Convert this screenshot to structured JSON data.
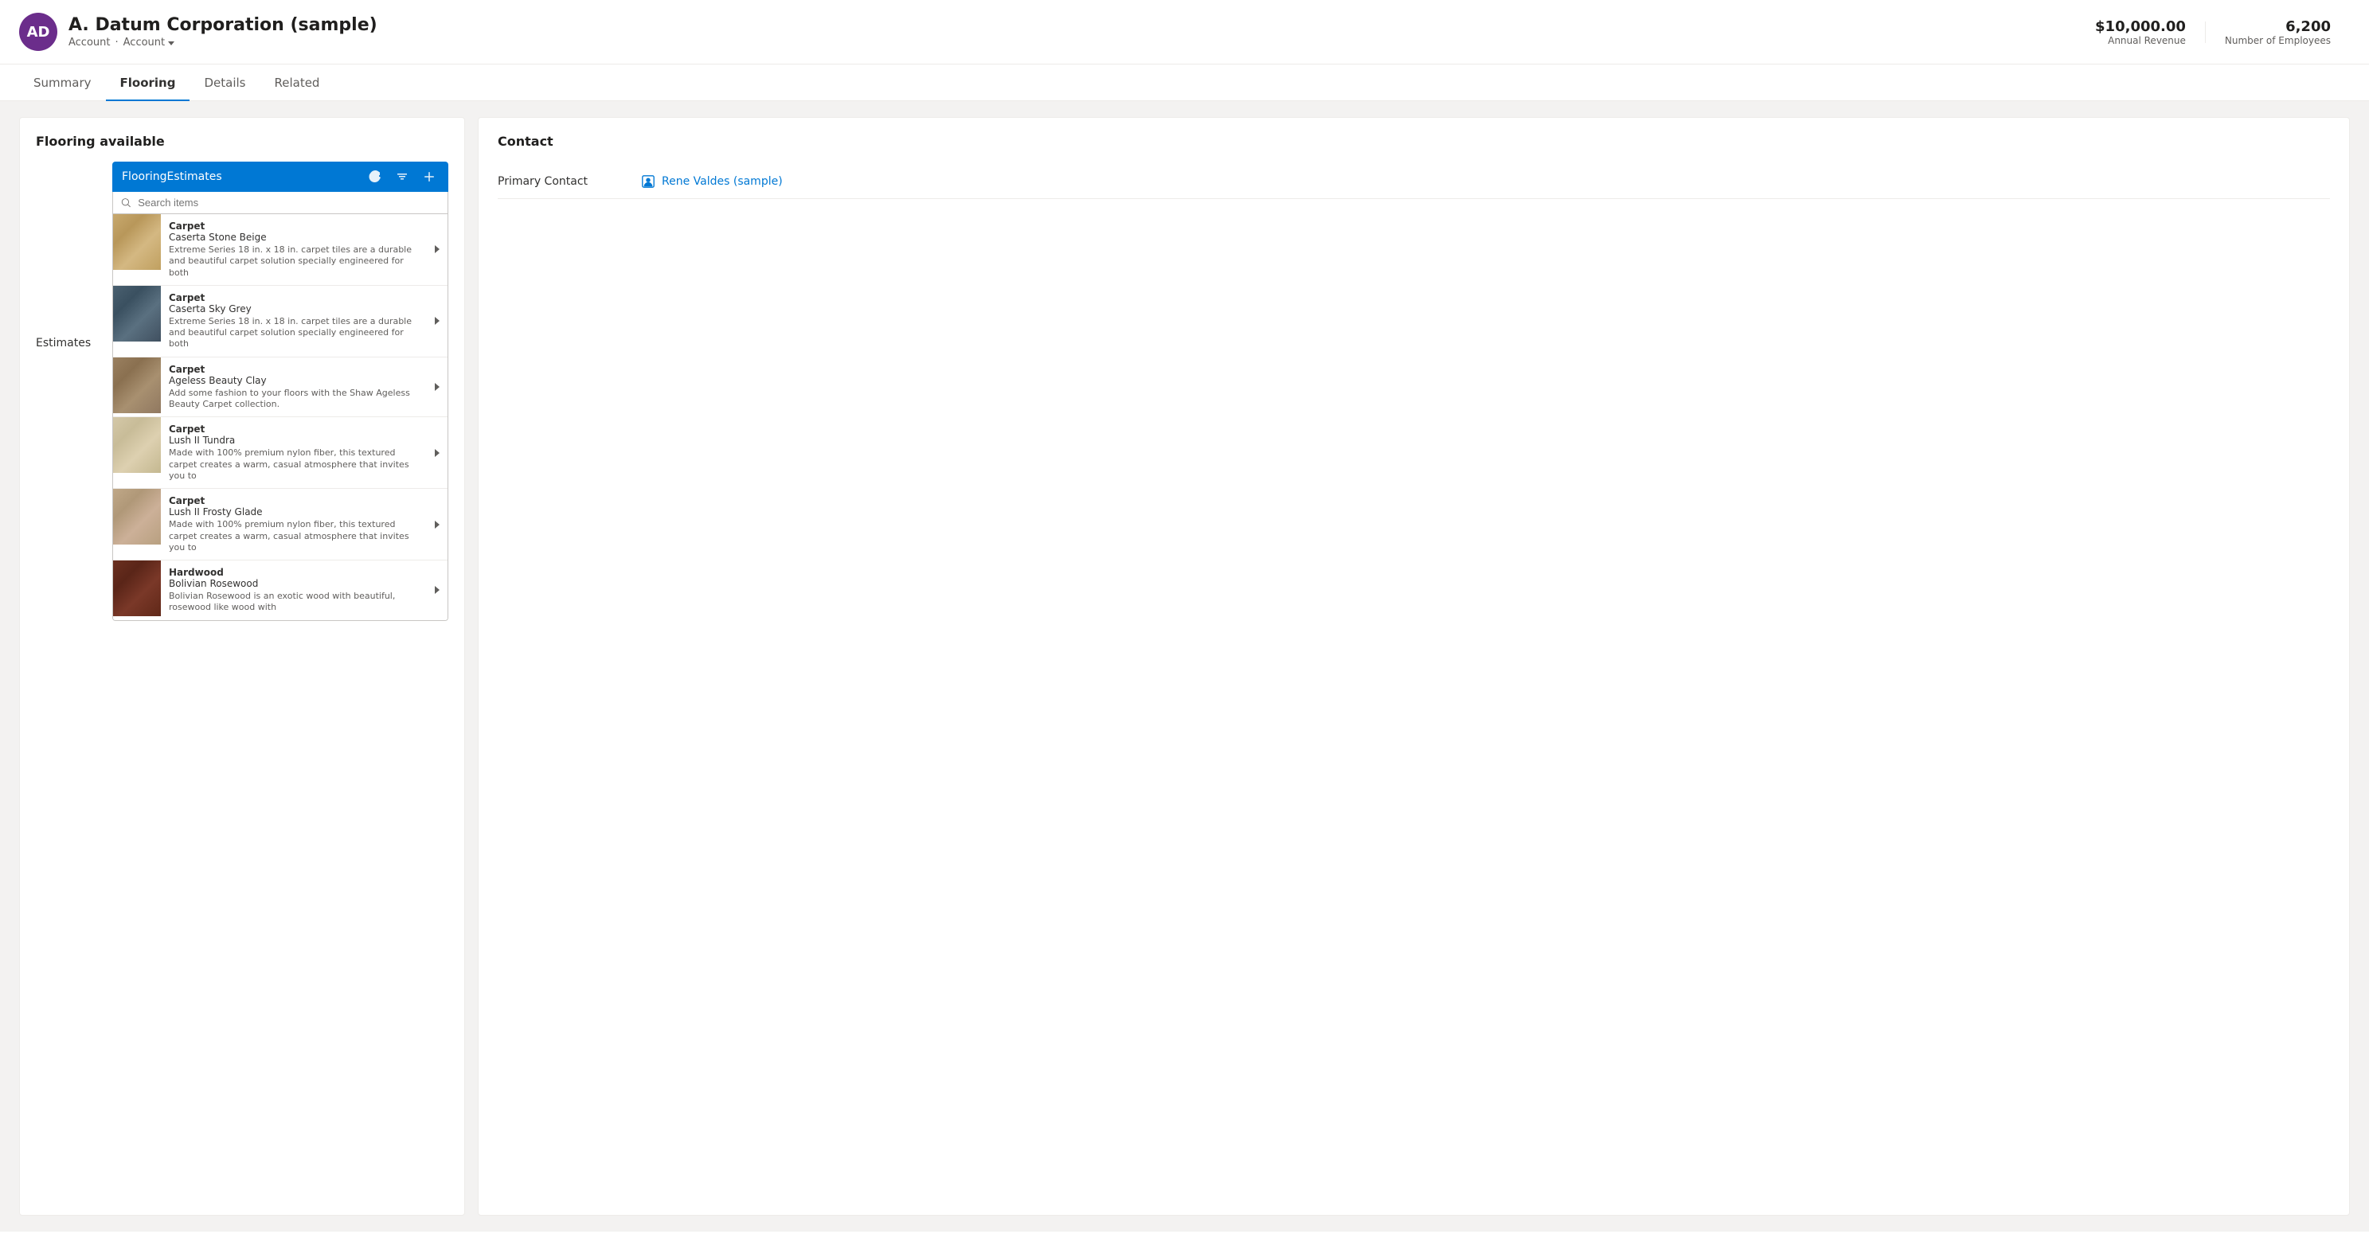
{
  "header": {
    "avatar_initials": "AD",
    "title": "A. Datum Corporation (sample)",
    "subtitle1": "Account",
    "subtitle2": "Account",
    "annual_revenue_label": "Annual Revenue",
    "annual_revenue_value": "$10,000.00",
    "employees_label": "Number of Employees",
    "employees_value": "6,200"
  },
  "nav": {
    "tabs": [
      {
        "label": "Summary",
        "active": false
      },
      {
        "label": "Flooring",
        "active": true
      },
      {
        "label": "Details",
        "active": false
      },
      {
        "label": "Related",
        "active": false
      }
    ]
  },
  "left_panel": {
    "title": "Flooring available",
    "sidebar_label": "Estimates",
    "toolbar_label": "FlooringEstimates",
    "search_placeholder": "Search items",
    "products": [
      {
        "category": "Carpet",
        "name": "Caserta Stone Beige",
        "description": "Extreme Series 18 in. x 18 in. carpet tiles are a durable and beautiful carpet solution specially engineered for both",
        "thumb_class": "thumb-beige"
      },
      {
        "category": "Carpet",
        "name": "Caserta Sky Grey",
        "description": "Extreme Series 18 in. x 18 in. carpet tiles are a durable and beautiful carpet solution specially engineered for both",
        "thumb_class": "thumb-grey"
      },
      {
        "category": "Carpet",
        "name": "Ageless Beauty Clay",
        "description": "Add some fashion to your floors with the Shaw Ageless Beauty Carpet collection.",
        "thumb_class": "thumb-clay"
      },
      {
        "category": "Carpet",
        "name": "Lush II Tundra",
        "description": "Made with 100% premium nylon fiber, this textured carpet creates a warm, casual atmosphere that invites you to",
        "thumb_class": "thumb-tundra"
      },
      {
        "category": "Carpet",
        "name": "Lush II Frosty Glade",
        "description": "Made with 100% premium nylon fiber, this textured carpet creates a warm, casual atmosphere that invites you to",
        "thumb_class": "thumb-frosty"
      },
      {
        "category": "Hardwood",
        "name": "Bolivian Rosewood",
        "description": "Bolivian Rosewood is an exotic wood with beautiful, rosewood like wood with",
        "thumb_class": "thumb-rosewood"
      }
    ]
  },
  "right_panel": {
    "title": "Contact",
    "primary_contact_label": "Primary Contact",
    "primary_contact_name": "Rene Valdes (sample)"
  },
  "icons": {
    "refresh": "↻",
    "sort": "⇅",
    "add": "+",
    "search": "🔍",
    "chevron_right": "›",
    "chevron_down": "∨",
    "person": "👤"
  }
}
